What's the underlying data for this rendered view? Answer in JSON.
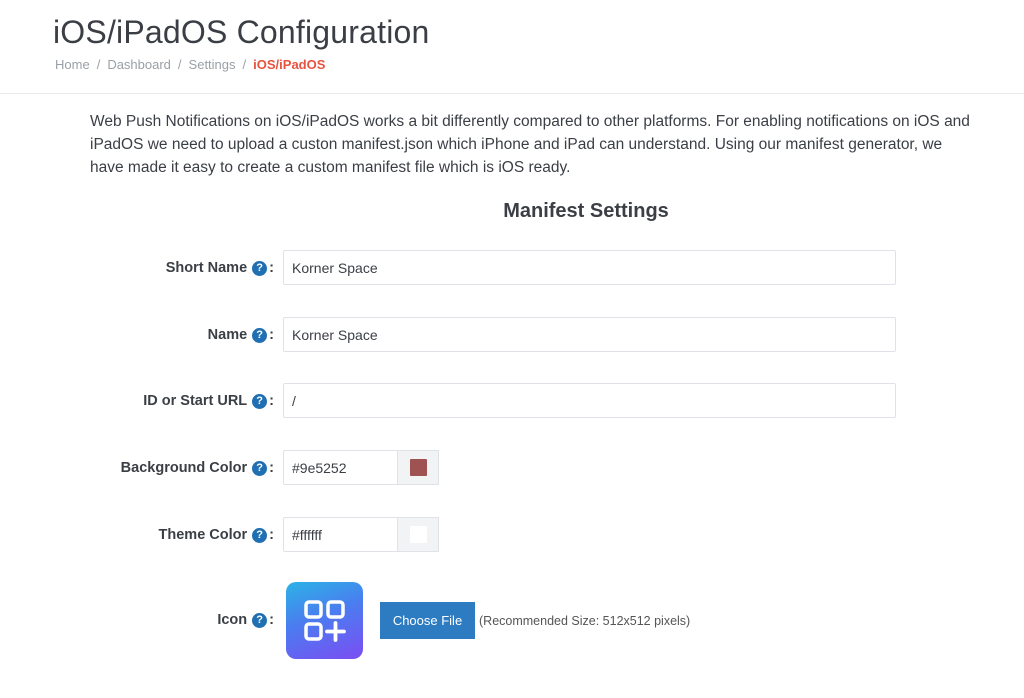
{
  "page": {
    "title": "iOS/iPadOS Configuration",
    "breadcrumb": [
      "Home",
      "Dashboard",
      "Settings",
      "iOS/iPadOS"
    ]
  },
  "intro": "Web Push Notifications on iOS/iPadOS works a bit differently compared to other platforms. For enabling notifications on iOS and iPadOS we need to upload a custon manifest.json which iPhone and iPad can understand. Using our manifest generator, we have made it easy to create a custom manifest file which is iOS ready.",
  "manifest": {
    "title": "Manifest Settings",
    "help_symbol": "?",
    "short_name": {
      "label": "Short Name",
      "value": "Korner Space"
    },
    "name": {
      "label": "Name",
      "value": "Korner Space"
    },
    "start_url": {
      "label": "ID or Start URL",
      "value": "/"
    },
    "background_color": {
      "label": "Background Color",
      "value": "#9e5252",
      "swatch": "#9e5252"
    },
    "theme_color": {
      "label": "Theme Color",
      "value": "#ffffff",
      "swatch": "#ffffff"
    },
    "icon": {
      "label": "Icon",
      "icon_name": "app-grid-plus-icon",
      "gradient": [
        "#2bb3e6",
        "#4b7cf0",
        "#7b4df3"
      ],
      "button": "Choose File",
      "recommendation": "(Recommended Size: 512x512 pixels)"
    }
  }
}
